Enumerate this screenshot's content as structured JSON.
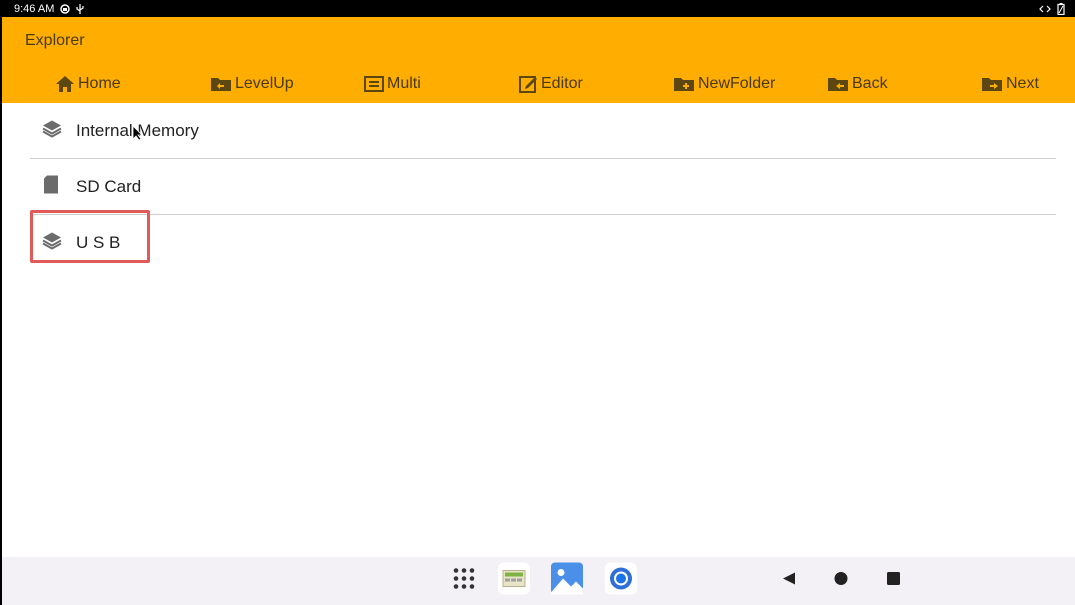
{
  "status_bar": {
    "time": "9:46 AM"
  },
  "app": {
    "title": "Explorer",
    "toolbar": [
      {
        "label": "Home",
        "icon": "home-icon"
      },
      {
        "label": "LevelUp",
        "icon": "folder-up-icon"
      },
      {
        "label": "Multi",
        "icon": "multi-select-icon"
      },
      {
        "label": "Editor",
        "icon": "edit-icon"
      },
      {
        "label": "NewFolder",
        "icon": "new-folder-icon"
      },
      {
        "label": "Back",
        "icon": "folder-back-icon"
      },
      {
        "label": "Next",
        "icon": "folder-next-icon"
      }
    ],
    "storage_list": [
      {
        "label": "Internal Memory",
        "icon": "layers-icon"
      },
      {
        "label": "SD Card",
        "icon": "sd-card-icon"
      },
      {
        "label": "U S B",
        "icon": "layers-icon"
      }
    ],
    "highlighted_item": "U S B"
  },
  "nav_bar": {
    "items": [
      "app-drawer-icon",
      "calculator-app-icon",
      "gallery-app-icon",
      "chrome-app-icon",
      "back-nav-icon",
      "home-nav-icon",
      "recents-nav-icon"
    ]
  },
  "colors": {
    "app_bar": "#FFAD00",
    "toolbar_text": "#4a3a10",
    "highlight_border": "#e05a5a",
    "nav_bar": "#f3f1f6"
  }
}
